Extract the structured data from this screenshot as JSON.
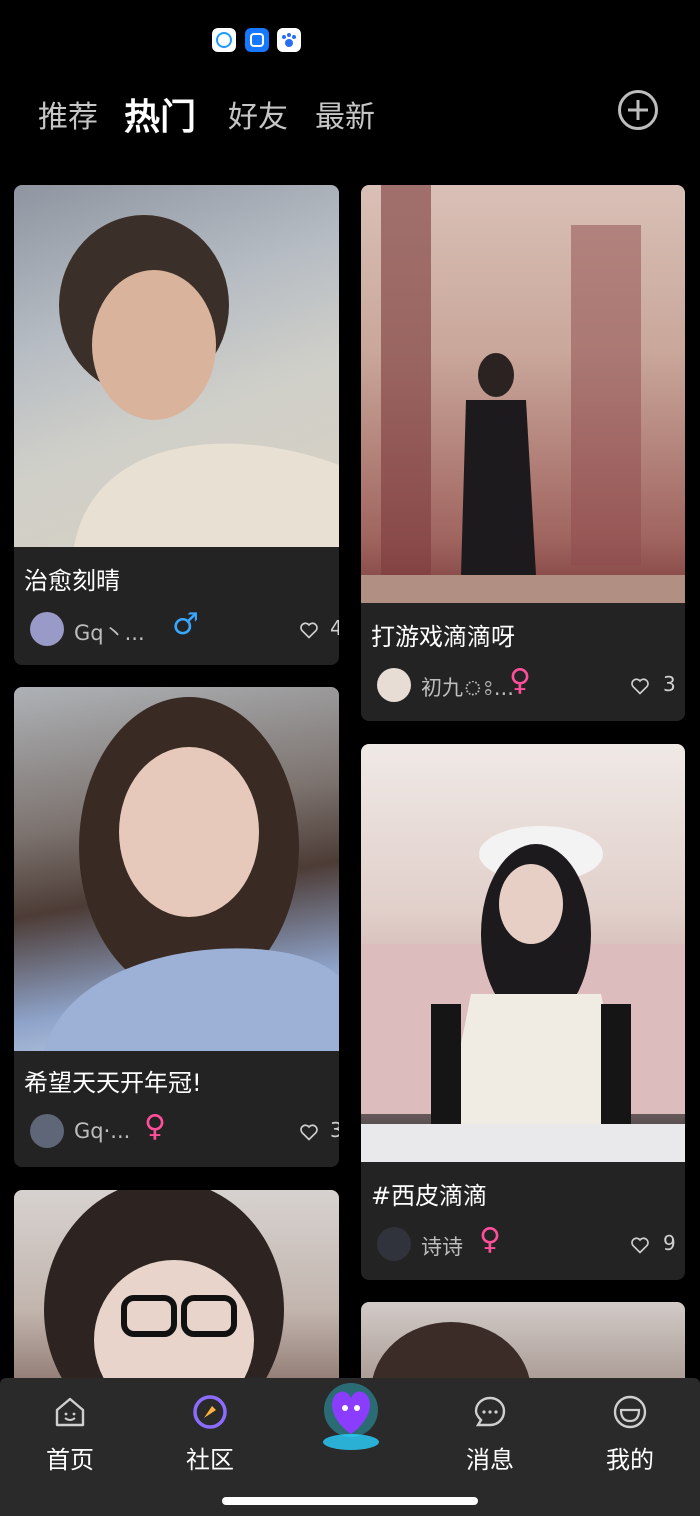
{
  "top_tabs": [
    {
      "label": "推荐",
      "active": false
    },
    {
      "label": "热门",
      "active": true
    },
    {
      "label": "好友",
      "active": false
    },
    {
      "label": "最新",
      "active": false
    }
  ],
  "add_icon": "plus-circle-icon",
  "cards": [
    {
      "title": "治愈刻晴",
      "user": "Gq丶...",
      "gender": "male",
      "gender_symbol": "♂",
      "likes": "4"
    },
    {
      "title": "打游戏滴滴呀",
      "user": "初九ঃ...",
      "gender": "female",
      "gender_symbol": "♀",
      "likes": "3"
    },
    {
      "title": "希望天天开年冠!",
      "user": "Gq·...",
      "gender": "female",
      "gender_symbol": "♀",
      "likes": "3"
    },
    {
      "title": "#西皮滴滴",
      "user": "诗诗",
      "gender": "female",
      "gender_symbol": "♀",
      "likes": "9"
    }
  ],
  "bottom_nav": [
    {
      "label": "首页",
      "icon": "home-icon"
    },
    {
      "label": "社区",
      "icon": "community-compass-icon"
    },
    {
      "label": "",
      "icon": "center-mascot-icon"
    },
    {
      "label": "消息",
      "icon": "message-bubble-icon"
    },
    {
      "label": "我的",
      "icon": "profile-smile-icon"
    }
  ],
  "colors": {
    "background": "#000000",
    "card": "#232323",
    "male": "#3aa7ff",
    "female": "#ff4f9a",
    "nav_accent": "#8b6cff"
  }
}
